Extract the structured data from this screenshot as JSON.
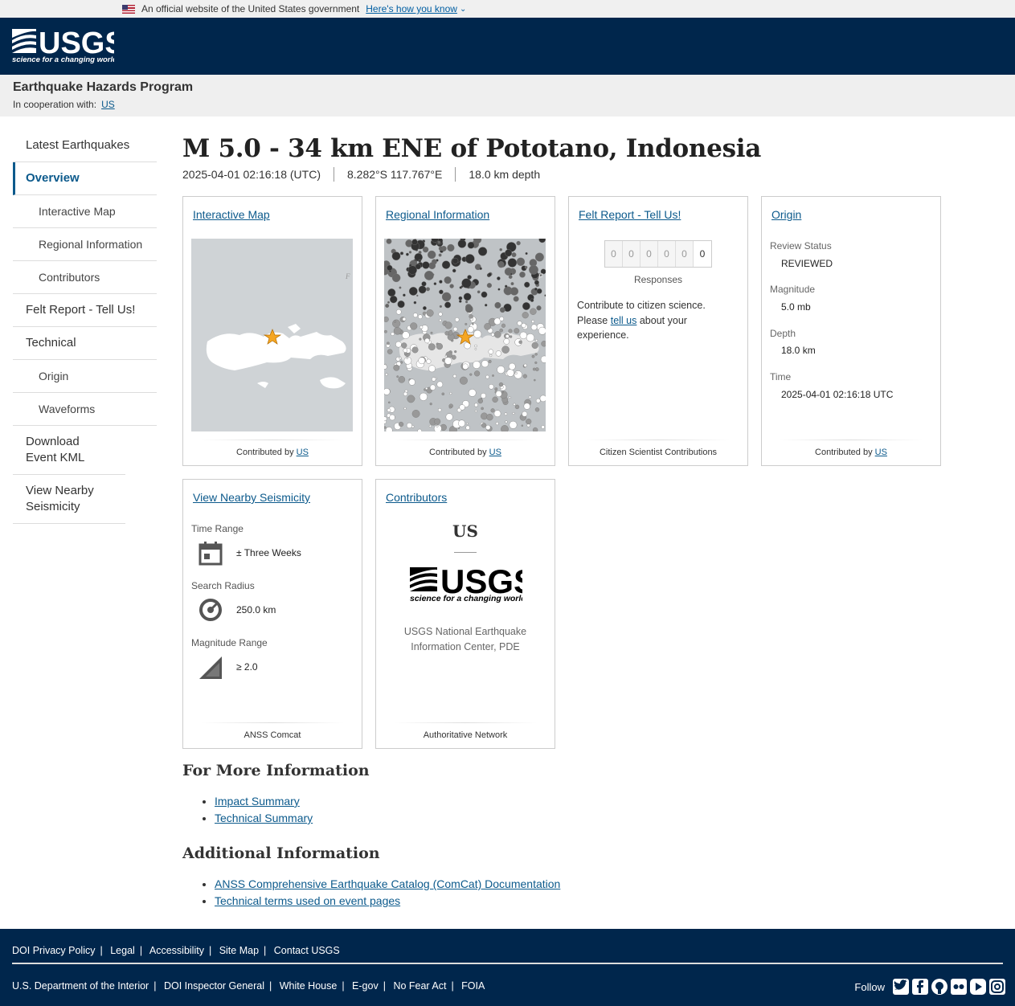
{
  "gov_banner": {
    "text": "An official website of the United States government",
    "how": "Here's how you know"
  },
  "header": {
    "logo_text": "USGS",
    "logo_tagline": "science for a changing world"
  },
  "program": {
    "title": "Earthquake Hazards Program",
    "coop_label": "In cooperation with:",
    "coop_link": "US"
  },
  "sidebar": {
    "items": [
      {
        "label": "Latest Earthquakes"
      },
      {
        "label": "Overview"
      },
      {
        "label": "Interactive Map"
      },
      {
        "label": "Regional Information"
      },
      {
        "label": "Contributors"
      },
      {
        "label": "Felt Report - Tell Us!"
      },
      {
        "label": "Technical"
      },
      {
        "label": "Origin"
      },
      {
        "label": "Waveforms"
      },
      {
        "label": "Download Event KML"
      },
      {
        "label": "View Nearby Seismicity"
      }
    ]
  },
  "event": {
    "title": "M 5.0 - 34 km ENE of Pototano, Indonesia",
    "time": "2025-04-01 02:16:18 (UTC)",
    "location": "8.282°S 117.767°E",
    "depth": "18.0 km depth"
  },
  "cards": {
    "interactive_map": {
      "title": "Interactive Map",
      "footer_prefix": "Contributed by",
      "footer_link": "US"
    },
    "regional": {
      "title": "Regional Information",
      "footer_prefix": "Contributed by",
      "footer_link": "US"
    },
    "felt": {
      "title": "Felt Report - Tell Us!",
      "digits": [
        "0",
        "0",
        "0",
        "0",
        "0",
        "0"
      ],
      "responses": "Responses",
      "text1": "Contribute to citizen science.",
      "text2": "Please",
      "text_link": "tell us",
      "text3": "about your experience.",
      "footer": "Citizen Scientist Contributions"
    },
    "origin": {
      "title": "Origin",
      "review_label": "Review Status",
      "review_value": "REVIEWED",
      "mag_label": "Magnitude",
      "mag_value": "5.0 mb",
      "depth_label": "Depth",
      "depth_value": "18.0 km",
      "time_label": "Time",
      "time_value": "2025-04-01 02:16:18 UTC",
      "footer_prefix": "Contributed by",
      "footer_link": "US"
    },
    "seismicity": {
      "title": "View Nearby Seismicity",
      "time_label": "Time Range",
      "time_value": "± Three Weeks",
      "radius_label": "Search Radius",
      "radius_value": "250.0 km",
      "mag_label": "Magnitude Range",
      "mag_value": "≥ 2.0",
      "footer": "ANSS Comcat"
    },
    "contributors": {
      "title": "Contributors",
      "code": "US",
      "logo_text": "USGS",
      "logo_tagline": "science for a changing world",
      "name": "USGS National Earthquake Information Center, PDE",
      "footer": "Authoritative Network"
    }
  },
  "more_info": {
    "heading": "For More Information",
    "links": [
      "Impact Summary",
      "Technical Summary"
    ]
  },
  "additional": {
    "heading": "Additional Information",
    "links": [
      "ANSS Comprehensive Earthquake Catalog (ComCat) Documentation",
      "Technical terms used on event pages"
    ]
  },
  "footer": {
    "row1": [
      "DOI Privacy Policy",
      "Legal",
      "Accessibility",
      "Site Map",
      "Contact USGS"
    ],
    "row2": [
      "U.S. Department of the Interior",
      "DOI Inspector General",
      "White House",
      "E-gov",
      "No Fear Act",
      "FOIA"
    ],
    "follow": "Follow",
    "social": [
      "twitter-icon",
      "facebook-icon",
      "github-icon",
      "flickr-icon",
      "youtube-icon",
      "instagram-icon"
    ]
  },
  "colors": {
    "header_bg": "#00264c",
    "link": "#0c5a8c",
    "active": "#0c5a8c",
    "star": "#f5a623"
  }
}
